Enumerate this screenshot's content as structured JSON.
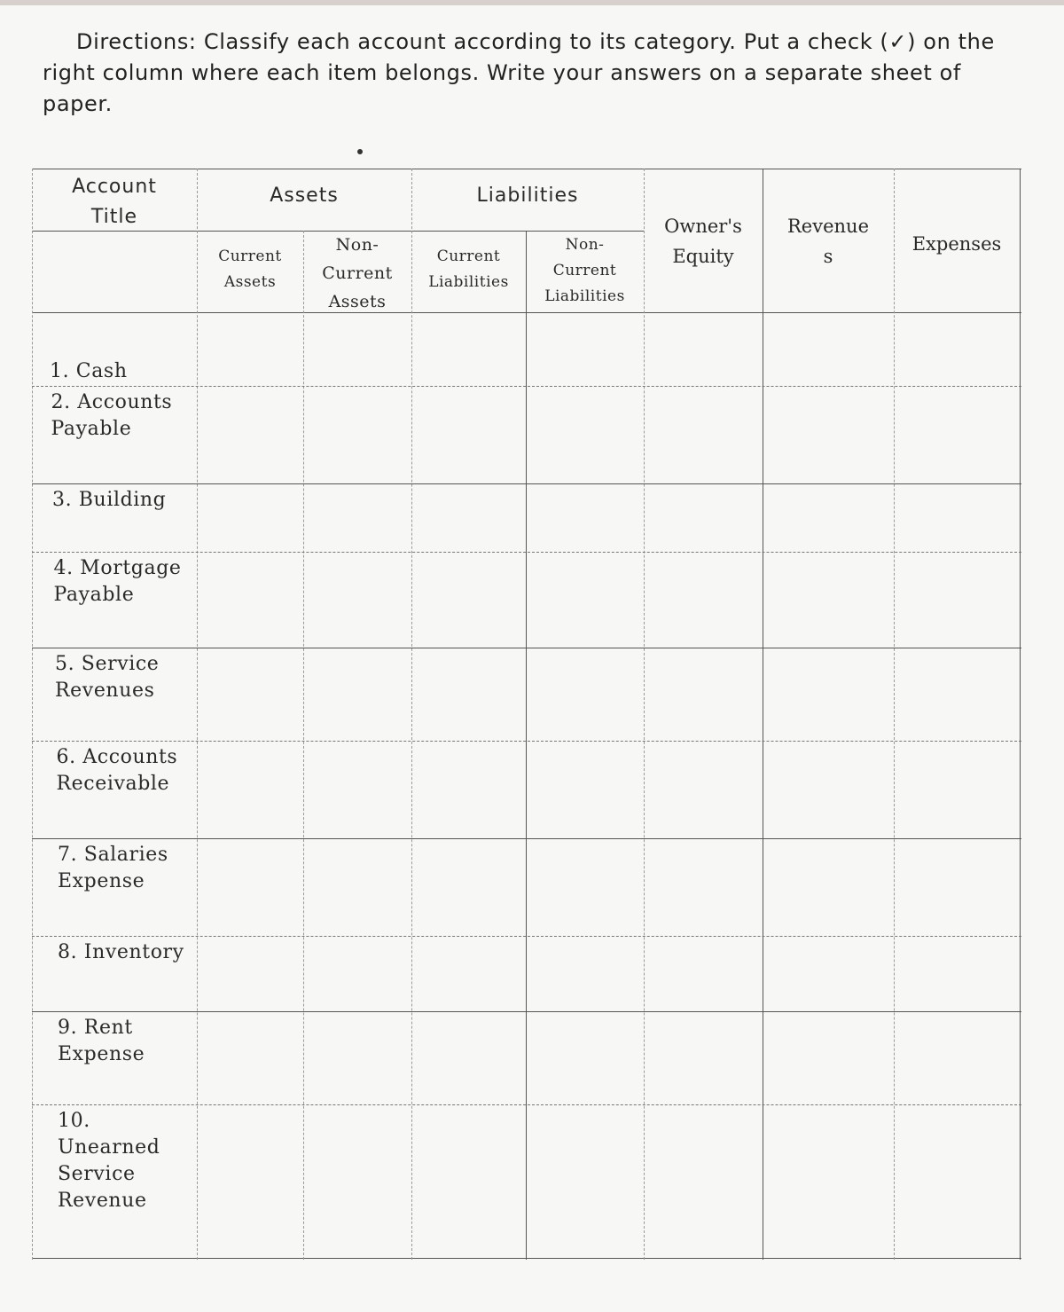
{
  "directions": "Directions: Classify each account according to its category. Put a check (✓) on the right column where each item belongs. Write your answers on a separate sheet of paper.",
  "table": {
    "header": {
      "account_title": "Account\nTitle",
      "assets": "Assets",
      "liabilities": "Liabilities",
      "owners_equity": "Owner's\nEquity",
      "revenues": "Revenue\ns",
      "expenses": "Expenses",
      "sub": {
        "current_assets": "Current\nAssets",
        "non_current_assets": "Non-\nCurrent\nAssets",
        "current_liabilities": "Current\nLiabilities",
        "non_current_liabilities": "Non-\nCurrent\nLiabilities"
      }
    },
    "rows": [
      {
        "label": "1. Cash"
      },
      {
        "label": "2. Accounts\nPayable"
      },
      {
        "label": "3. Building"
      },
      {
        "label": "4. Mortgage\nPayable"
      },
      {
        "label": "5. Service\nRevenues"
      },
      {
        "label": "6. Accounts\nReceivable"
      },
      {
        "label": "7. Salaries\nExpense"
      },
      {
        "label": "8. Inventory"
      },
      {
        "label": "9. Rent\nExpense"
      },
      {
        "label": "10.\nUnearned\nService\nRevenue"
      }
    ]
  }
}
